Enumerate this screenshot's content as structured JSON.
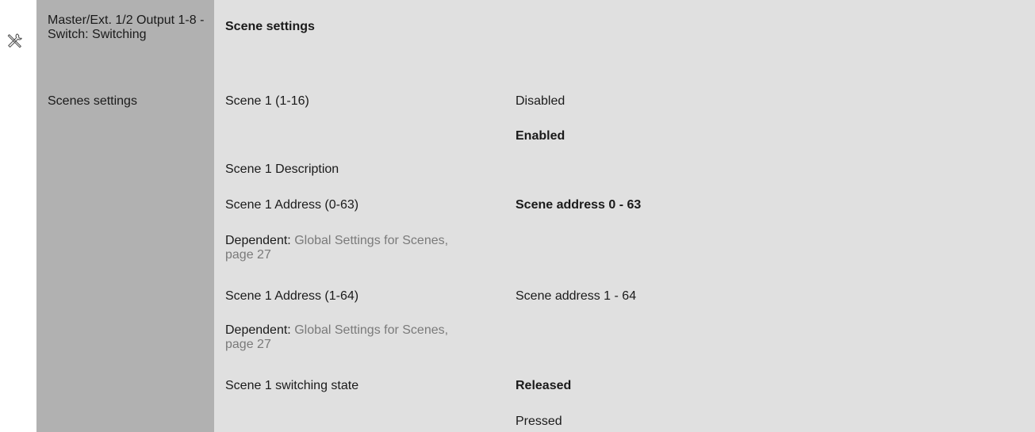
{
  "sidebar_icon": "wrench-screwdriver-icon",
  "section_title": "Master/Ext. 1/2 Output 1-8 -Switch: Switching",
  "group_label": "Scenes settings",
  "header": "Scene settings",
  "rows": [
    {
      "param": "Scene 1 (1-16)",
      "value": "Disabled"
    },
    {
      "param": "",
      "value": "Enabled"
    },
    {
      "param": "Scene 1 Description",
      "value": ""
    },
    {
      "param": "Scene 1 Address (0-63)",
      "value": "Scene address 0 - 63"
    },
    {
      "dependent_label": "Dependent:",
      "dependent_link": "Global Settings for Scenes, page 27"
    },
    {
      "param": "Scene 1 Address (1-64)",
      "value": "Scene address 1 - 64"
    },
    {
      "dependent_label": "Dependent:",
      "dependent_link": "Global Settings for Scenes, page 27"
    },
    {
      "param": "Scene 1 switching state",
      "value": "Released"
    },
    {
      "param": "",
      "value": "Pressed"
    }
  ]
}
